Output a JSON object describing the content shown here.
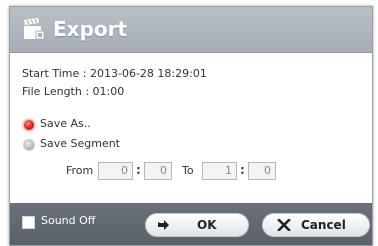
{
  "dialog": {
    "title": "Export",
    "title_icon": "clapperboard-icon"
  },
  "info": {
    "start_time": "Start Time : 2013-06-28 18:29:01",
    "file_length": "File Length : 01:00"
  },
  "options": {
    "save_as": "Save As..",
    "save_segment": "Save Segment",
    "selected": "save_as"
  },
  "segment": {
    "from_label": "From",
    "to_label": "To",
    "from_min": "0",
    "from_sec": "0",
    "to_min": "1",
    "to_sec": "0",
    "separator": ":"
  },
  "footer": {
    "sound_off_label": "Sound Off",
    "sound_off_checked": false,
    "ok_label": "OK",
    "ok_icon": "arrow-right-icon",
    "cancel_label": "Cancel",
    "cancel_icon": "x-icon"
  },
  "colors": {
    "title_bar": "#afb5bc",
    "footer_bar": "#61686f",
    "radio_selected": "#e52b1f"
  }
}
